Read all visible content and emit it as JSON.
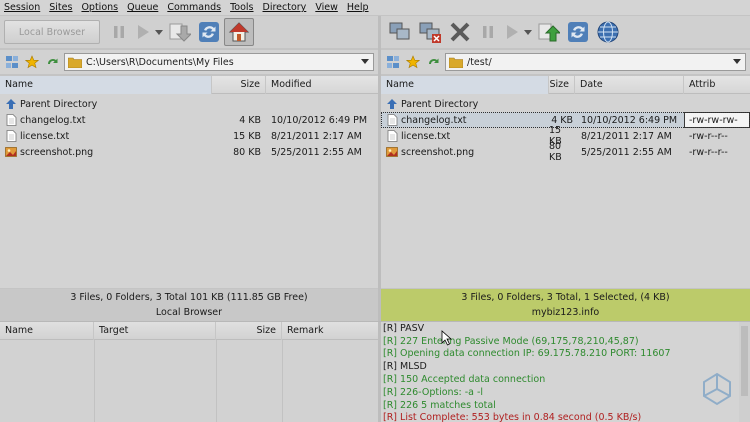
{
  "menu": [
    "Session",
    "Sites",
    "Options",
    "Queue",
    "Commands",
    "Tools",
    "Directory",
    "View",
    "Help"
  ],
  "toolbar": {
    "local_browser_label": "Local Browser"
  },
  "left_path": "C:\\Users\\R\\Documents\\My Files",
  "right_path": "/test/",
  "left_columns": [
    "Name",
    "Size",
    "Modified"
  ],
  "right_columns": [
    "Name",
    "Size",
    "Date",
    "Attrib"
  ],
  "parent_dir_label": "Parent Directory",
  "left_files": [
    {
      "name": "changelog.txt",
      "size": "4 KB",
      "modified": "10/10/2012 6:49 PM",
      "icon": "text-file-icon"
    },
    {
      "name": "license.txt",
      "size": "15 KB",
      "modified": "8/21/2011 2:17 AM",
      "icon": "text-file-icon"
    },
    {
      "name": "screenshot.png",
      "size": "80 KB",
      "modified": "5/25/2011 2:55 AM",
      "icon": "image-file-icon"
    }
  ],
  "right_files": [
    {
      "name": "changelog.txt",
      "size": "4 KB",
      "date": "10/10/2012 6:49 PM",
      "attrib": "-rw-rw-rw-",
      "icon": "text-file-icon",
      "selected": true
    },
    {
      "name": "license.txt",
      "size": "15 KB",
      "date": "8/21/2011 2:17 AM",
      "attrib": "-rw-r--r--",
      "icon": "text-file-icon"
    },
    {
      "name": "screenshot.png",
      "size": "80 KB",
      "date": "5/25/2011 2:55 AM",
      "attrib": "-rw-r--r--",
      "icon": "image-file-icon"
    }
  ],
  "left_status": {
    "line1": "3 Files, 0 Folders, 3 Total 101 KB (111.85 GB Free)",
    "line2": "Local Browser"
  },
  "right_status": {
    "line1": "3 Files, 0 Folders, 3 Total, 1 Selected, (4 KB)",
    "line2": "mybiz123.info"
  },
  "queue_columns": [
    "Name",
    "Target",
    "Size",
    "Remark"
  ],
  "log": [
    {
      "text": "[R] PASV",
      "color": "k"
    },
    {
      "text": "[R] 227 Entering Passive Mode (69,175,78,210,45,87)",
      "color": "g"
    },
    {
      "text": "[R] Opening data connection IP: 69.175.78.210 PORT: 11607",
      "color": "g"
    },
    {
      "text": "[R] MLSD",
      "color": "k"
    },
    {
      "text": "[R] 150 Accepted data connection",
      "color": "g"
    },
    {
      "text": "[R] 226-Options: -a -l",
      "color": "g"
    },
    {
      "text": "[R] 226 5 matches total",
      "color": "g"
    },
    {
      "text": "[R] List Complete: 553 bytes in 0.84 second (0.5 KB/s)",
      "color": "r"
    }
  ],
  "colors": {
    "remote_status_bg": "#bccb6a",
    "log_green": "#2e8a2e",
    "log_red": "#b02020"
  }
}
